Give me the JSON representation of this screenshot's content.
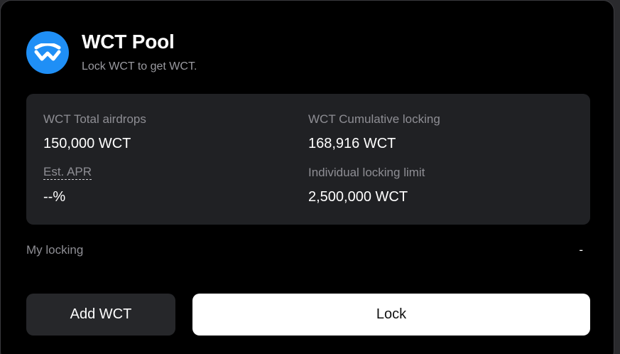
{
  "pool": {
    "title": "WCT Pool",
    "subtitle": "Lock WCT to get WCT.",
    "logo_icon": "walletconnect-logo-icon",
    "logo_color": "#1f8ff6"
  },
  "stats": {
    "total_airdrops_label": "WCT Total airdrops",
    "total_airdrops_value": "150,000 WCT",
    "cumulative_locking_label": "WCT Cumulative locking",
    "cumulative_locking_value": "168,916 WCT",
    "apr_label": "Est. APR",
    "apr_value": "--%",
    "locking_limit_label": "Individual locking limit",
    "locking_limit_value": "2,500,000 WCT"
  },
  "my_locking": {
    "label": "My locking",
    "value": "-"
  },
  "actions": {
    "add_label": "Add WCT",
    "lock_label": "Lock"
  }
}
